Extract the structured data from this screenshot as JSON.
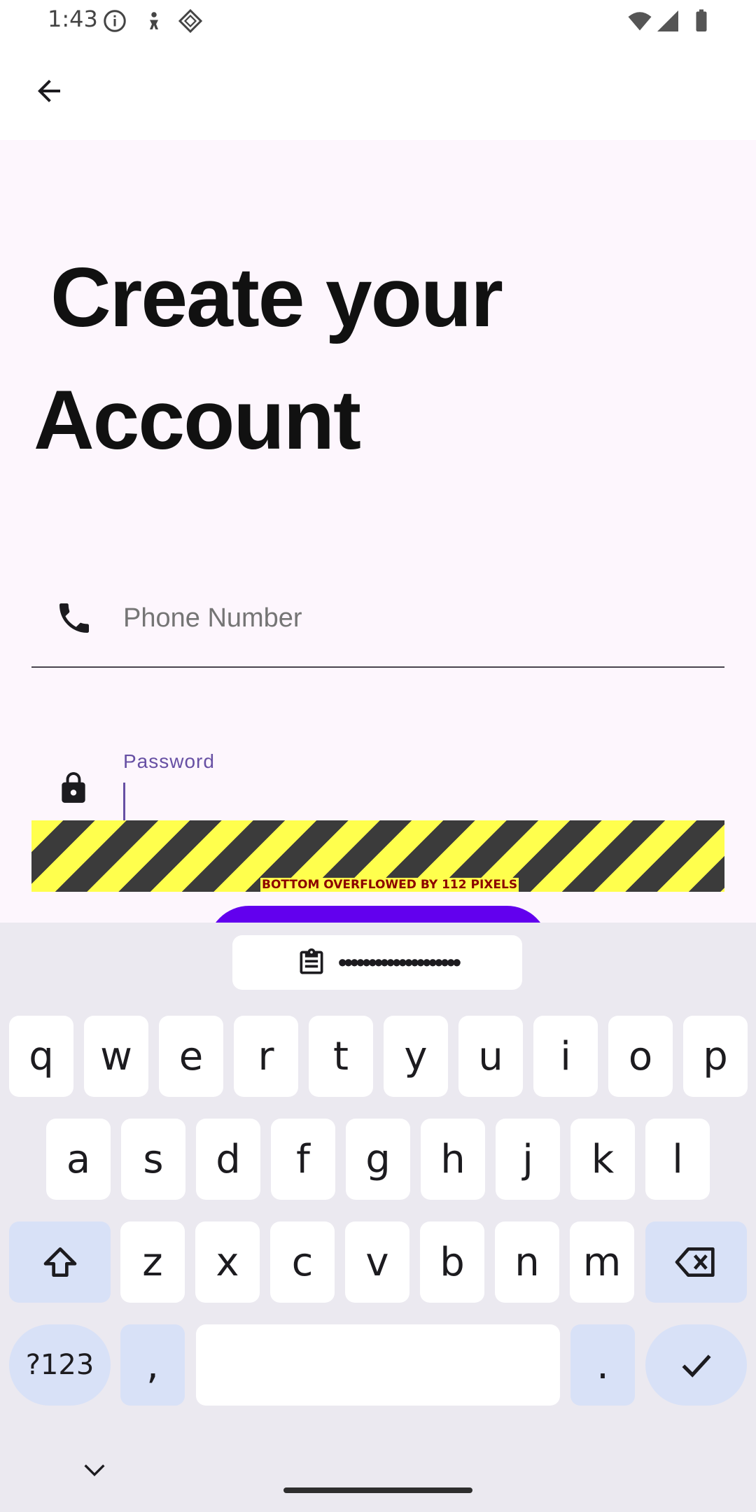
{
  "status_bar": {
    "time": "1:43"
  },
  "title": {
    "line1": "Create your",
    "line2": "Account"
  },
  "phone": {
    "placeholder": "Phone Number"
  },
  "password": {
    "label": "Password"
  },
  "overflow": {
    "message": "BOTTOM OVERFLOWED BY 112 PIXELS"
  },
  "clipboard": {
    "text": "••••••••••••••••••••"
  },
  "keyboard": {
    "row1": [
      "q",
      "w",
      "e",
      "r",
      "t",
      "y",
      "u",
      "i",
      "o",
      "p"
    ],
    "row2": [
      "a",
      "s",
      "d",
      "f",
      "g",
      "h",
      "j",
      "k",
      "l"
    ],
    "row3": [
      "z",
      "x",
      "c",
      "v",
      "b",
      "n",
      "m"
    ],
    "symbols_label": "?123",
    "comma": ",",
    "period": "."
  },
  "colors": {
    "accent": "#6750a4",
    "button": "#6200ee",
    "background": "#fdf6fd"
  }
}
